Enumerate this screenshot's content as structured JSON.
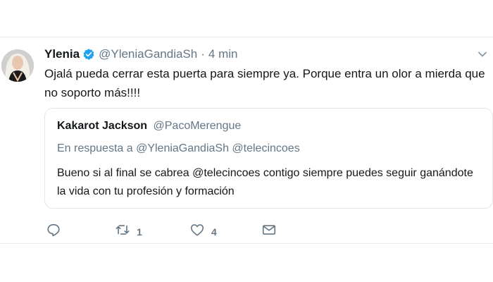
{
  "tweet": {
    "display_name": "Ylenia",
    "handle": "@YleniaGandiaSh",
    "separator": "·",
    "time": "4 min",
    "text": "Ojalá pueda cerrar esta puerta para siempre ya. Porque entra un olor a mierda que no soporto más!!!!",
    "verified": true,
    "icons": {
      "verified": "verified-badge-icon",
      "caret": "chevron-down-icon"
    }
  },
  "quote": {
    "display_name": "Kakarot Jackson",
    "handle": "@PacoMerengue",
    "reply_prefix": "En respuesta a",
    "reply_mentions": "@YleniaGandiaSh @telecincoes",
    "text": "Bueno si al final se cabrea @telecincoes  contigo siempre puedes seguir ganándote la vida con tu profesión y formación"
  },
  "actions": {
    "reply": {
      "icon": "reply-icon"
    },
    "retweet": {
      "icon": "retweet-icon",
      "count": "1"
    },
    "like": {
      "icon": "heart-icon",
      "count": "4"
    },
    "dm": {
      "icon": "envelope-icon"
    }
  },
  "colors": {
    "verified_blue": "#1da1f2",
    "secondary_text": "#657786",
    "border": "#e6ecf0"
  }
}
